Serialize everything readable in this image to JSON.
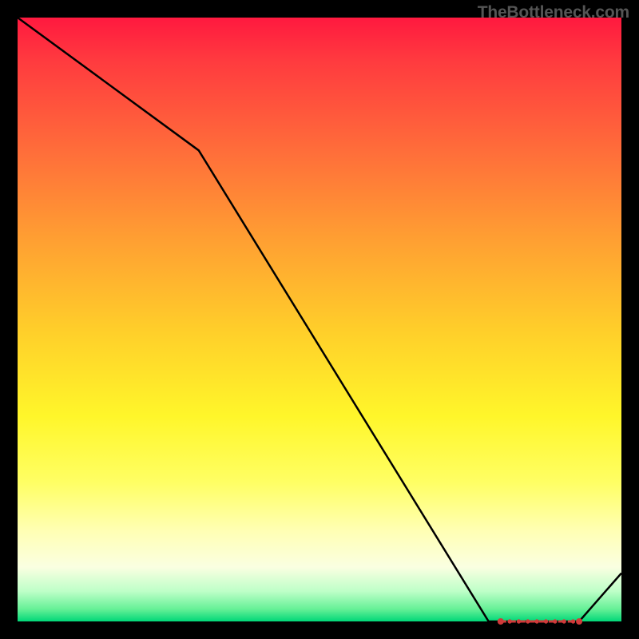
{
  "watermark": "TheBottleneck.com",
  "chart_data": {
    "type": "line",
    "title": "",
    "xlabel": "",
    "ylabel": "",
    "xlim": [
      0,
      100
    ],
    "ylim": [
      0,
      100
    ],
    "series": [
      {
        "name": "bottleneck-curve",
        "x": [
          0,
          30,
          78,
          82,
          93,
          100
        ],
        "values": [
          100,
          78,
          0,
          0,
          0,
          8
        ]
      },
      {
        "name": "optimal-markers",
        "x": [
          80,
          81.5,
          83,
          84.5,
          86,
          87.5,
          89,
          90.5,
          92,
          93
        ],
        "values": [
          0,
          0,
          0,
          0,
          0,
          0,
          0,
          0,
          0,
          0
        ]
      }
    ],
    "gradient_stops": [
      {
        "pos": 0.0,
        "color": "#ff193f"
      },
      {
        "pos": 0.22,
        "color": "#ff6d3a"
      },
      {
        "pos": 0.52,
        "color": "#ffcf2a"
      },
      {
        "pos": 0.77,
        "color": "#ffff64"
      },
      {
        "pos": 0.95,
        "color": "#beffc8"
      },
      {
        "pos": 1.0,
        "color": "#00d778"
      }
    ],
    "marker_color": "#d03a3a"
  }
}
